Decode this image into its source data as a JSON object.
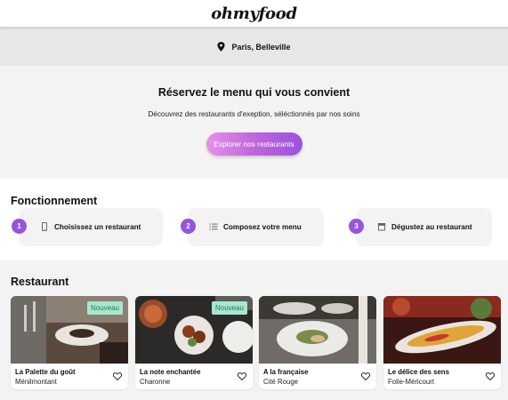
{
  "header": {
    "logo": "ohmyfood"
  },
  "location": {
    "icon": "location-pin-icon",
    "text": "Paris, Belleville"
  },
  "hero": {
    "title": "Réservez le menu qui vous convient",
    "subtitle": "Découvrez des restaurants d'exeption, séléctionnés par nos soins",
    "cta_label": "Explorer nos restaurants"
  },
  "how": {
    "title": "Fonctionnement",
    "steps": [
      {
        "number": "1",
        "icon": "smartphone-icon",
        "label": "Choisissez un restaurant"
      },
      {
        "number": "2",
        "icon": "list-icon",
        "label": "Composez votre menu"
      },
      {
        "number": "3",
        "icon": "store-icon",
        "label": "Dégustez au restaurant"
      }
    ]
  },
  "restaurants": {
    "title": "Restaurant",
    "items": [
      {
        "name": "La Palette du goût",
        "location": "Ménilmontant",
        "badge": "Nouveau"
      },
      {
        "name": "La note enchantée",
        "location": "Charonne",
        "badge": "Nouveau"
      },
      {
        "name": "A la française",
        "location": "Cité Rouge",
        "badge": ""
      },
      {
        "name": "Le délice des sens",
        "location": "Folie-Méricourt",
        "badge": ""
      }
    ]
  },
  "colors": {
    "accent_purple": "#9356dc",
    "cta_gradient_start": "#e690ea",
    "cta_gradient_end": "#9a52e0",
    "badge_bg": "#a8e6cd",
    "badge_text": "#1f7a58"
  }
}
